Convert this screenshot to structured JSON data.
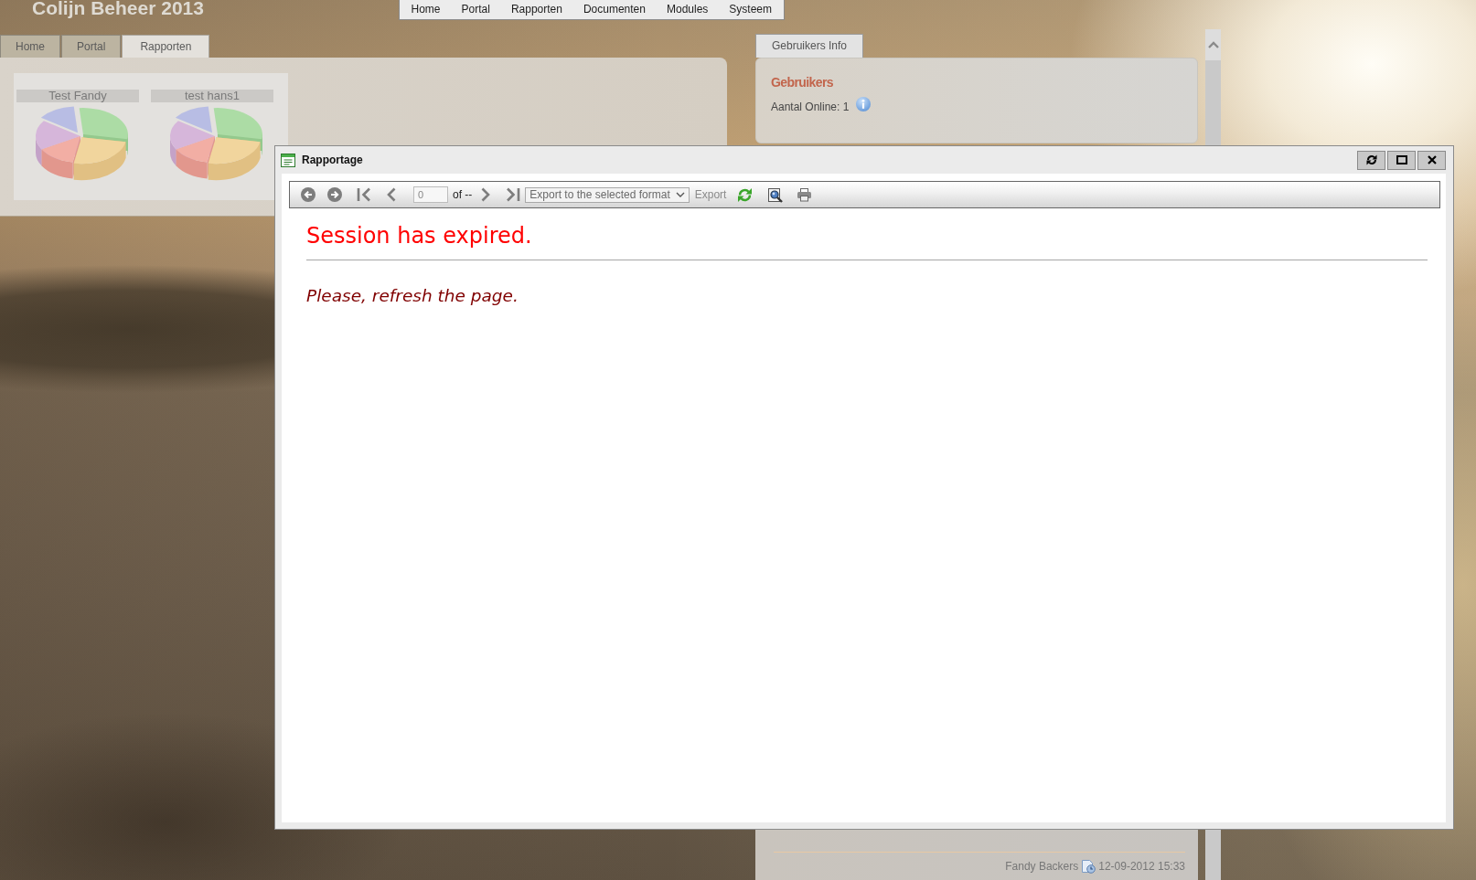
{
  "app_title": "Colijn Beheer 2013",
  "top_menu": [
    "Home",
    "Portal",
    "Rapporten",
    "Documenten",
    "Modules",
    "Systeem"
  ],
  "tabs": [
    {
      "label": "Home",
      "selected": false
    },
    {
      "label": "Portal",
      "selected": false
    },
    {
      "label": "Rapporten",
      "selected": true
    }
  ],
  "report_tiles": [
    {
      "title": "Test Fandy"
    },
    {
      "title": "test hans1"
    }
  ],
  "info_panel": {
    "tab_label": "Gebruikers Info",
    "heading": "Gebruikers",
    "online_count": "Aantal Online: 1"
  },
  "footer": {
    "author": "Fandy Backers",
    "timestamp": "12-09-2012 15:33"
  },
  "dialog": {
    "title": "Rapportage",
    "toolbar": {
      "page_input": {
        "value": "0"
      },
      "page_count": "of --",
      "export_format": {
        "value": "Export to the selected format"
      },
      "export_button": {
        "label": "Export",
        "disabled": true
      }
    },
    "error_title": "Session has expired.",
    "error_message": "Please, refresh the page."
  }
}
